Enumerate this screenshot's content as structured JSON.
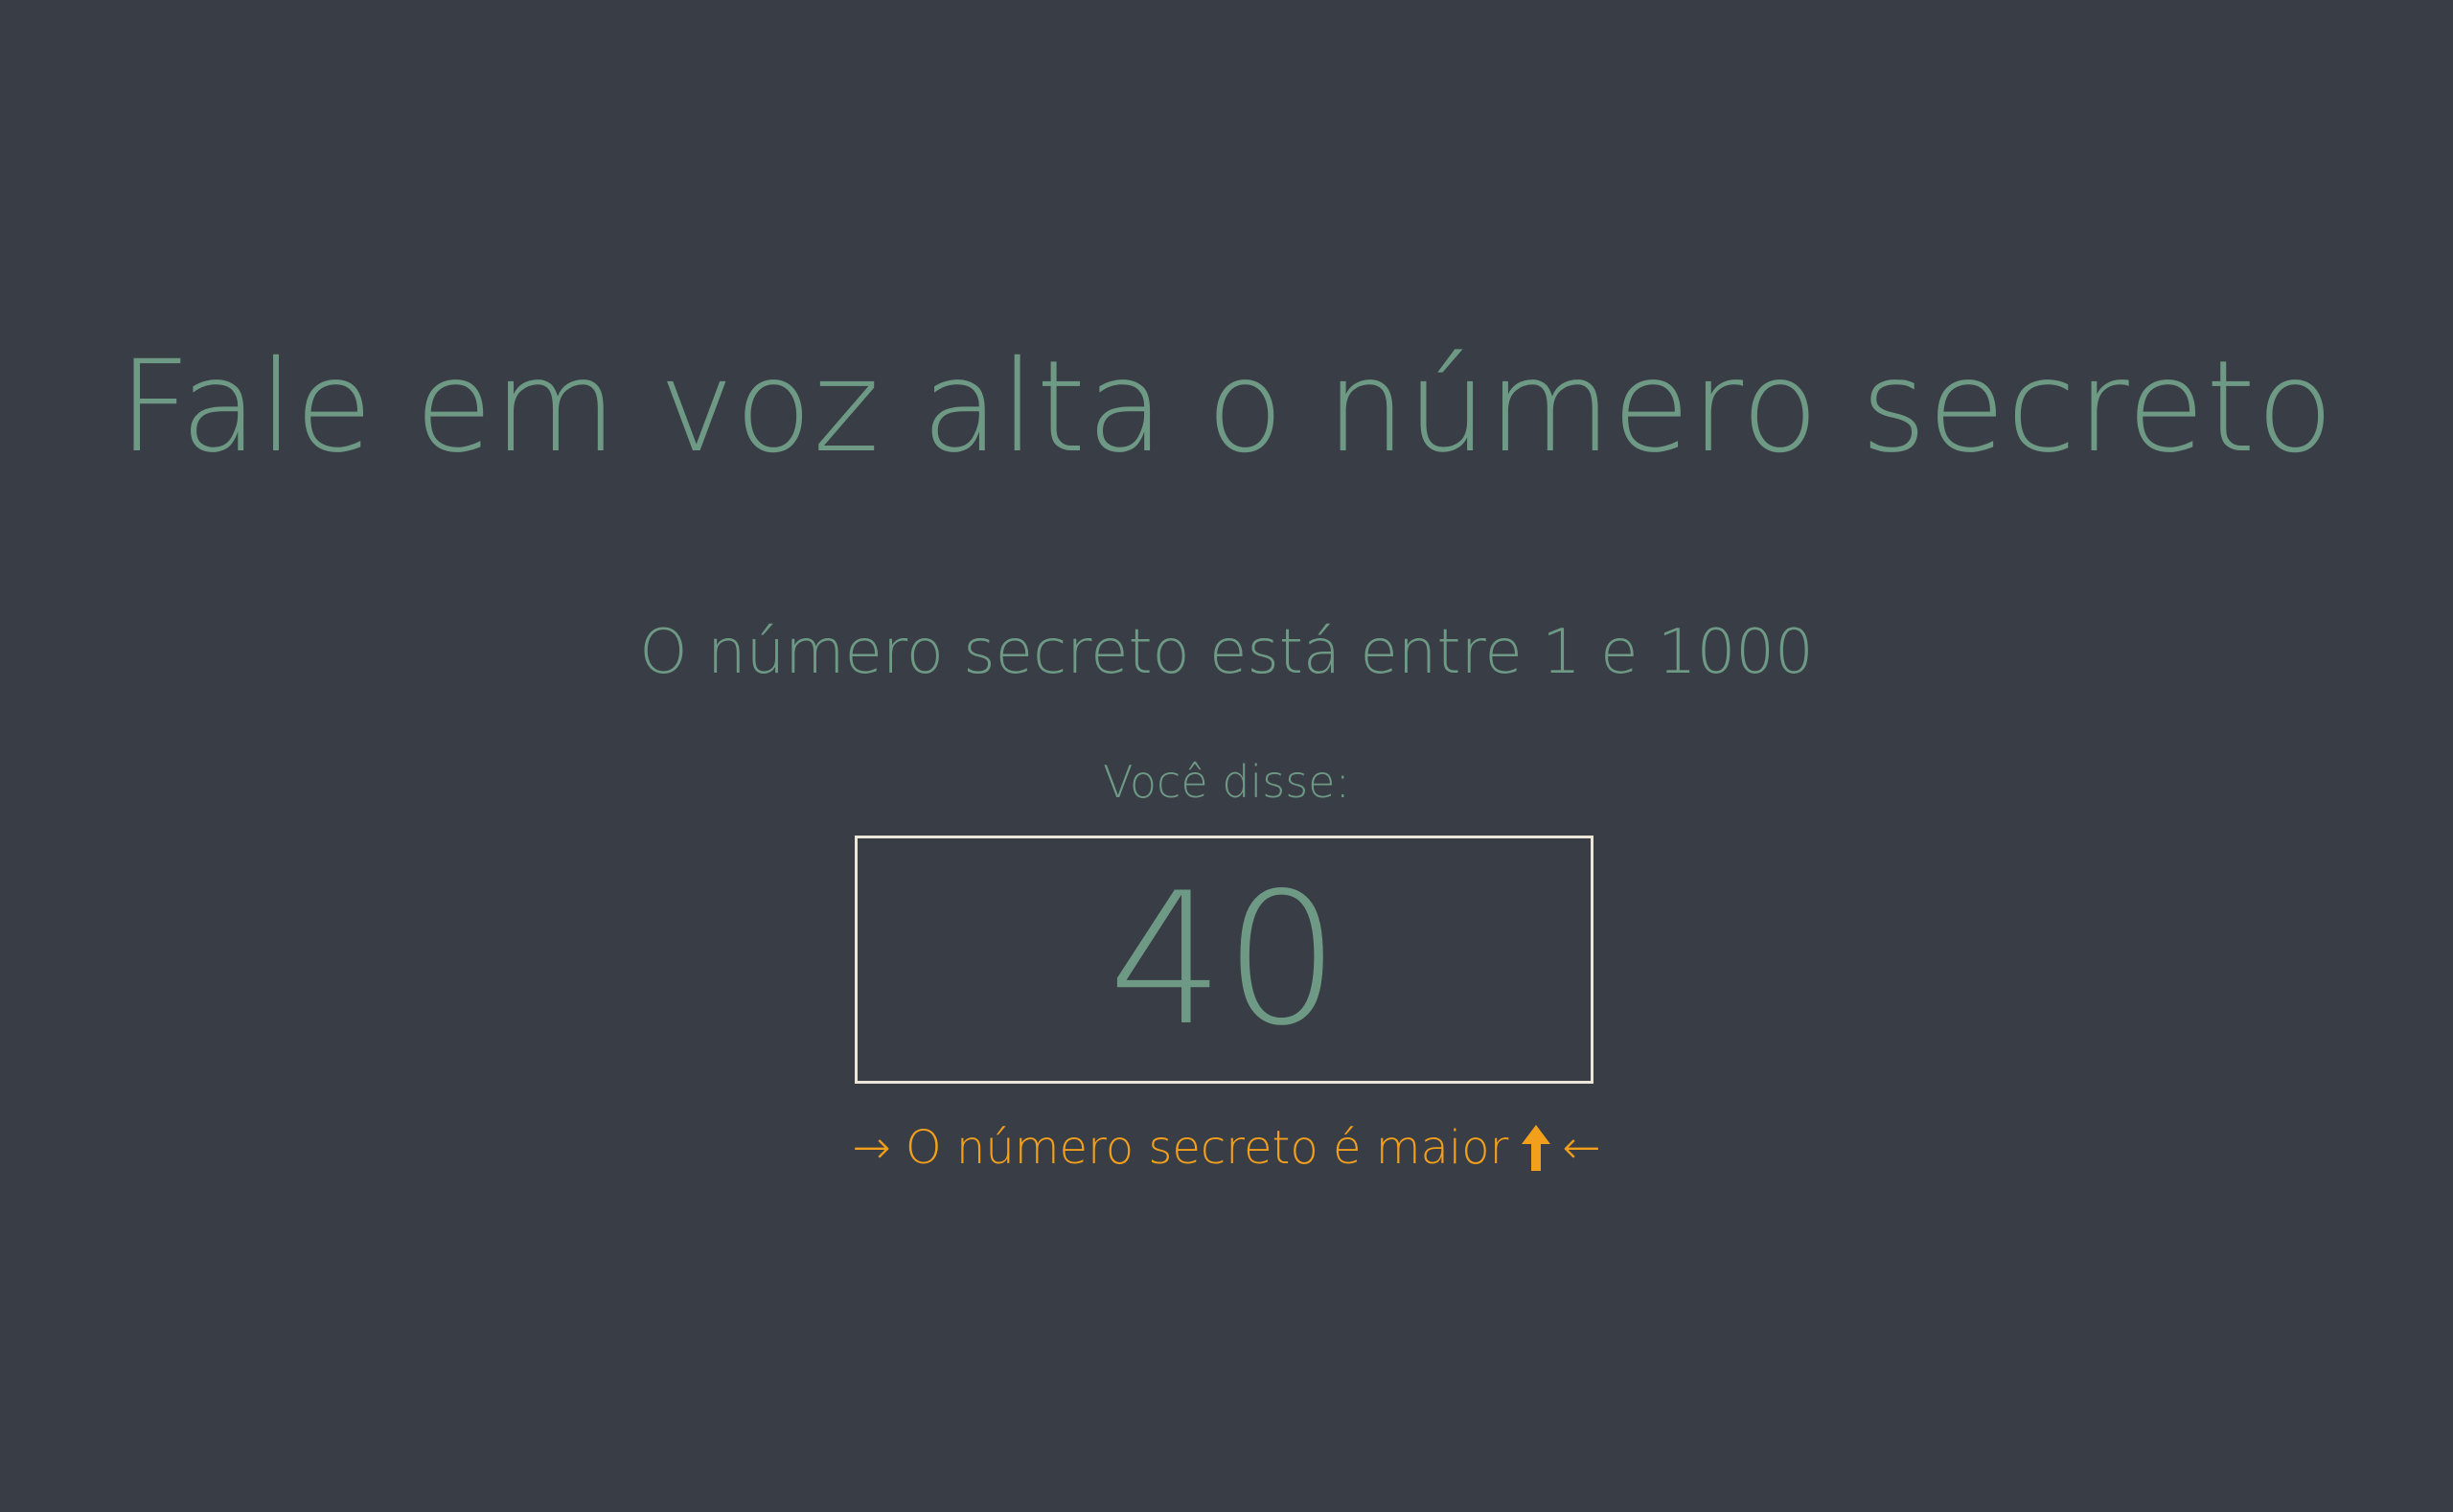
{
  "title": "Fale em voz alta o número secreto",
  "range_text": "O número secreto está entre 1 e 1000",
  "said_label": "Você disse:",
  "guess": "40",
  "hint": {
    "left_arrow": "→",
    "text": "O número secreto é maior",
    "icon": "up-arrow-icon",
    "right_arrow": "←"
  },
  "colors": {
    "background": "#393d46",
    "text": "#6e9a85",
    "hint": "#f2a01c",
    "box_border": "#ece6d6"
  }
}
